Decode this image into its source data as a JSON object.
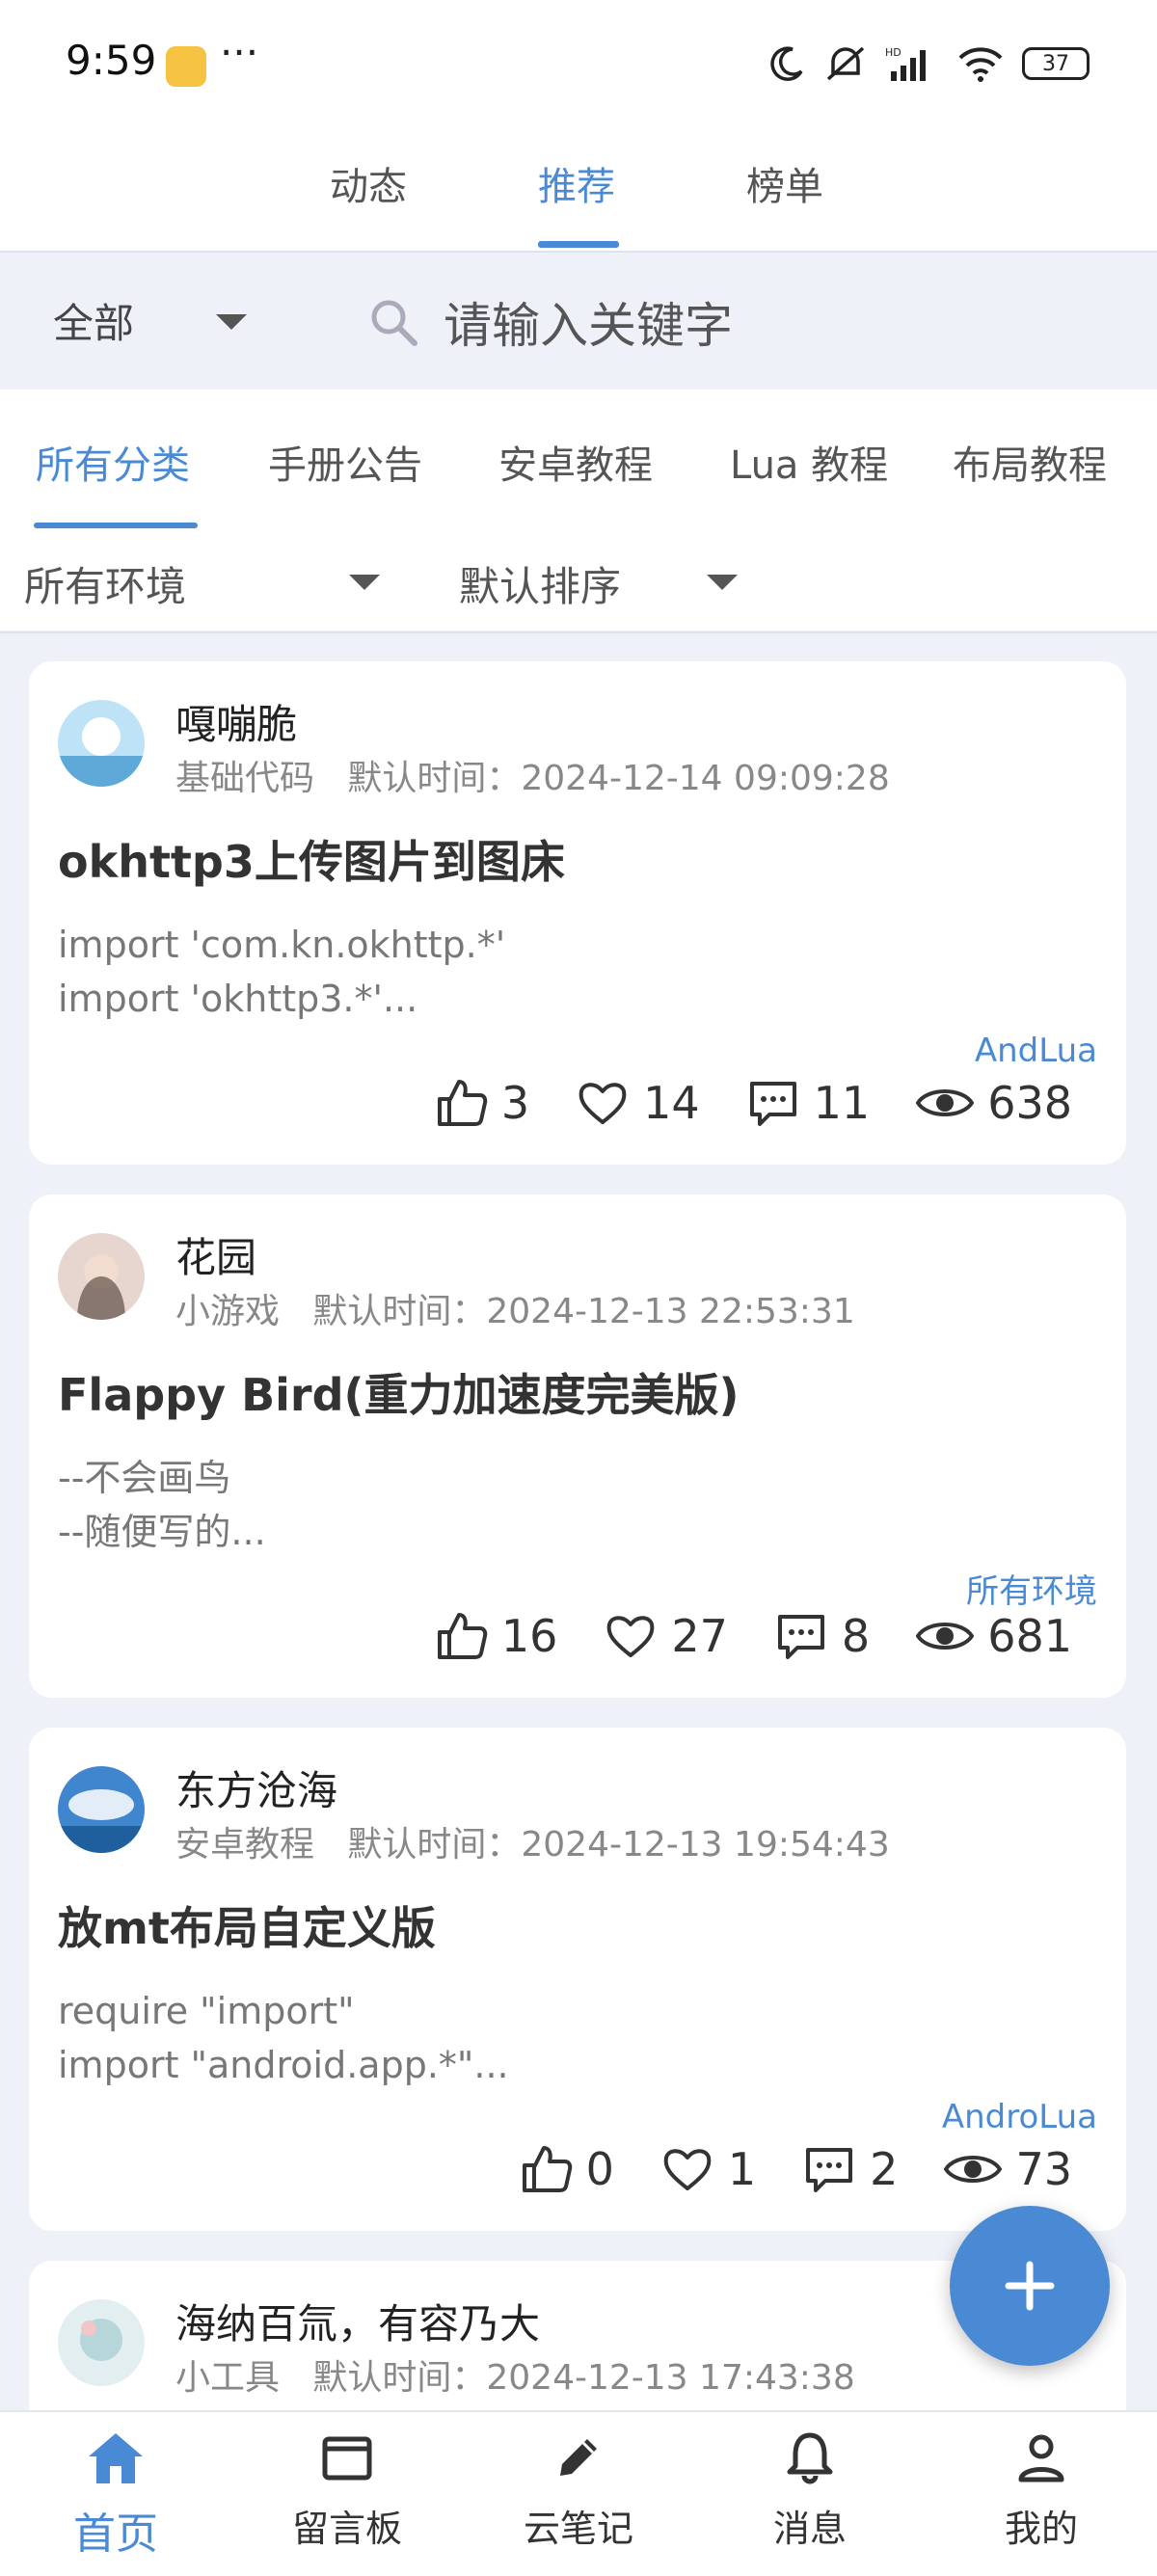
{
  "status_bar": {
    "time": "9:59",
    "more": "···",
    "battery": "37"
  },
  "top_tabs": [
    {
      "label": "动态",
      "active": false
    },
    {
      "label": "推荐",
      "active": true
    },
    {
      "label": "榜单",
      "active": false
    }
  ],
  "search": {
    "scope": "全部",
    "placeholder": "请输入关键字"
  },
  "categories": [
    "所有分类",
    "手册公告",
    "安卓教程",
    "Lua 教程",
    "布局教程"
  ],
  "filters": {
    "environment": "所有环境",
    "sort": "默认排序"
  },
  "posts": [
    {
      "author": "嘎嘣脆",
      "category": "基础代码",
      "time_label": "默认时间：",
      "time": "2024-12-14 09:09:28",
      "title": "okhttp3上传图片到图床",
      "line1": "import 'com.kn.okhttp.*'",
      "line2": "import 'okhttp3.*'...",
      "env": "AndLua",
      "likes": "3",
      "favorites": "14",
      "comments": "11",
      "views": "638",
      "avatar_color": "#8ec8ee"
    },
    {
      "author": "花园",
      "category": "小游戏",
      "time_label": "默认时间：",
      "time": "2024-12-13 22:53:31",
      "title": "Flappy Bird(重力加速度完美版)",
      "line1": "--不会画鸟",
      "line2": "--随便写的...",
      "env": "所有环境",
      "likes": "16",
      "favorites": "27",
      "comments": "8",
      "views": "681",
      "avatar_color": "#c9a79a"
    },
    {
      "author": "东方沧海",
      "category": "安卓教程",
      "time_label": "默认时间：",
      "time": "2024-12-13 19:54:43",
      "title": "放mt布局自定义版",
      "line1": "require \"import\"",
      "line2": "import \"android.app.*\"...",
      "env": "AndroLua",
      "likes": "0",
      "favorites": "1",
      "comments": "2",
      "views": "73",
      "avatar_color": "#4f93d3"
    },
    {
      "author": "海纳百氚，有容乃大",
      "category": "小工具",
      "time_label": "默认时间：",
      "time": "2024-12-13 17:43:38",
      "avatar_color": "#cfe3e6"
    }
  ],
  "bottom_nav": [
    {
      "label": "首页",
      "icon": "home-icon",
      "active": true
    },
    {
      "label": "留言板",
      "icon": "board-icon",
      "active": false
    },
    {
      "label": "云笔记",
      "icon": "pencil-icon",
      "active": false
    },
    {
      "label": "消息",
      "icon": "bell-icon",
      "active": false
    },
    {
      "label": "我的",
      "icon": "user-icon",
      "active": false
    }
  ],
  "colors": {
    "accent": "#4a8ad4",
    "background": "#eef2f8"
  }
}
